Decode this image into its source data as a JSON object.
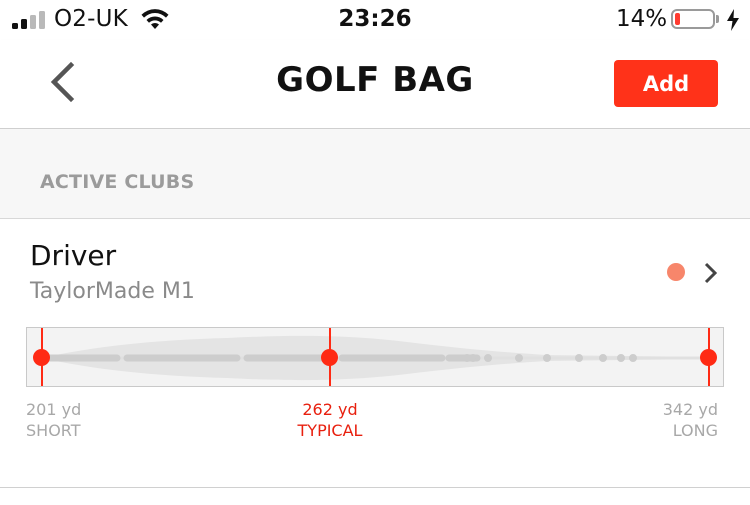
{
  "status_bar": {
    "carrier": "O2-UK",
    "time": "23:26",
    "battery_percent": "14%",
    "battery_level": 0.14,
    "icons": [
      "signal-icon",
      "wifi-icon",
      "battery-icon",
      "charging-bolt-icon"
    ]
  },
  "navbar": {
    "title": "GOLF BAG",
    "back_icon": "chevron-left-icon",
    "add_label": "Add",
    "accent_color": "#ff3219"
  },
  "section": {
    "title": "ACTIVE CLUBS"
  },
  "clubs": [
    {
      "name": "Driver",
      "model": "TaylorMade M1",
      "status_color": "#f7866b",
      "chevron_icon": "chevron-right-icon",
      "distance_range": {
        "unit": "yd",
        "short": {
          "value": "201 yd",
          "label": "SHORT",
          "yards": 201
        },
        "typical": {
          "value": "262 yd",
          "label": "TYPICAL",
          "yards": 262
        },
        "long": {
          "value": "342 yd",
          "label": "LONG",
          "yards": 342
        }
      }
    }
  ]
}
